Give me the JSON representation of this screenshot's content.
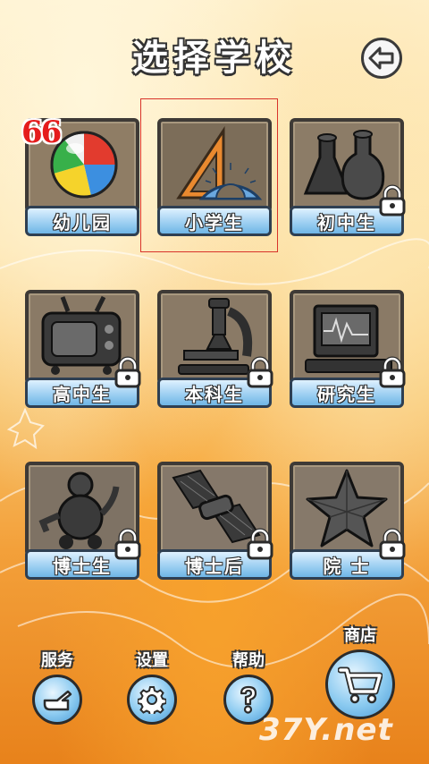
{
  "header": {
    "title": "选择学校",
    "back_icon": "back-arrow-icon"
  },
  "badge": {
    "value": "66"
  },
  "levels": [
    {
      "label": "幼儿园",
      "icon": "beach-ball-icon",
      "locked": false
    },
    {
      "label": "小学生",
      "icon": "ruler-protractor-icon",
      "locked": false,
      "selected": true
    },
    {
      "label": "初中生",
      "icon": "chemistry-flask-icon",
      "locked": true
    },
    {
      "label": "高中生",
      "icon": "television-icon",
      "locked": true
    },
    {
      "label": "本科生",
      "icon": "microscope-icon",
      "locked": true
    },
    {
      "label": "研究生",
      "icon": "oscilloscope-monitor-icon",
      "locked": true
    },
    {
      "label": "博士生",
      "icon": "robot-icon",
      "locked": true
    },
    {
      "label": "博士后",
      "icon": "satellite-icon",
      "locked": true
    },
    {
      "label": "院 士",
      "icon": "star-icon",
      "locked": true
    }
  ],
  "bottom_bar": {
    "service": {
      "label": "服务",
      "icon": "hand-pointer-icon"
    },
    "settings": {
      "label": "设置",
      "icon": "gear-icon"
    },
    "help": {
      "label": "帮助",
      "icon": "question-mark-icon"
    },
    "shop": {
      "label": "商店",
      "icon": "shopping-cart-icon"
    }
  },
  "watermark": {
    "text": "37Y.net"
  }
}
